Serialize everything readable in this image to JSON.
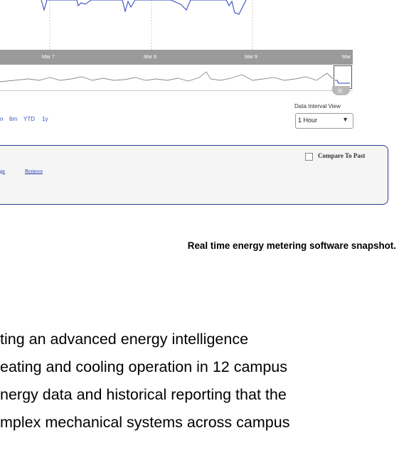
{
  "chart": {
    "date_ticks": [
      "Mar 7",
      "Mar 8",
      "Mar 9",
      "Mar"
    ]
  },
  "controls": {
    "range_buttons": [
      "n",
      "6m",
      "YTD",
      "1y"
    ],
    "interval_label": "Data Interval View",
    "interval_value": "1 Hour"
  },
  "panel": {
    "compare_label": "Compare To Past",
    "link_partial": "ge",
    "link_remove": "Remove"
  },
  "caption": "Real time energy metering software snapshot.",
  "body_text": [
    "ting an advanced energy intelligence",
    "eating and cooling operation in 12 campus",
    "nergy data and historical reporting that the",
    "mplex mechanical systems across campus"
  ],
  "colors": {
    "series": "#2a3fb8",
    "date_bar": "#9a9a9a",
    "panel_border": "#2a3d8f",
    "link": "#2f51c8"
  }
}
